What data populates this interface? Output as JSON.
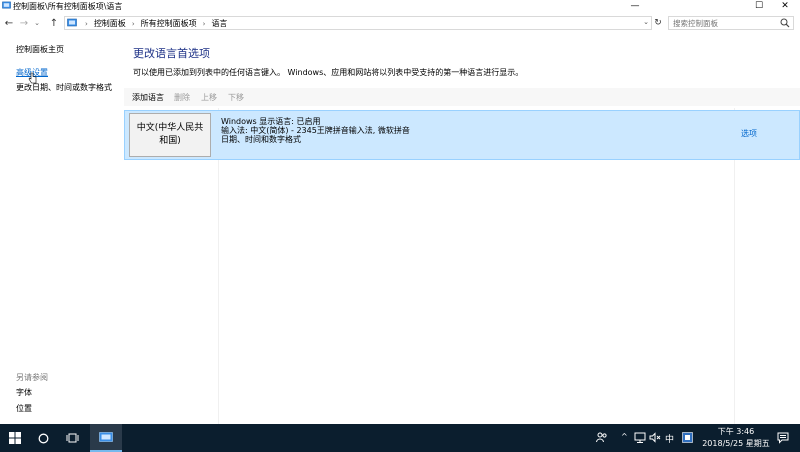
{
  "window": {
    "title": "控制面板\\所有控制面板项\\语言",
    "controls": {
      "minimize": "—",
      "maximize": "☐",
      "close": "✕"
    }
  },
  "address": {
    "back": "←",
    "forward": "→",
    "recent": "⌄",
    "up": "↑",
    "breadcrumbs": [
      "控制面板",
      "所有控制面板项",
      "语言"
    ],
    "separator": "›",
    "dropdown": "⌄",
    "refresh": "↻",
    "search_placeholder": "搜索控制面板"
  },
  "sidebar": {
    "home": "控制面板主页",
    "advanced": "高级设置",
    "datetime": "更改日期、时间或数字格式",
    "see_also": "另请参阅",
    "fonts": "字体",
    "location": "位置"
  },
  "main": {
    "title": "更改语言首选项",
    "description": "可以使用已添加到列表中的任何语言键入。 Windows、应用和网站将以列表中受支持的第一种语言进行显示。",
    "toolbar": {
      "add": "添加语言",
      "delete": "删除",
      "up": "上移",
      "down": "下移"
    },
    "language": {
      "name": "中文(中华人民共和国)",
      "display": "Windows 显示语言: 已启用",
      "input": "输入法: 中文(简体) - 2345王牌拼音输入法, 微软拼音",
      "format": "日期、时间和数字格式",
      "options": "选项"
    }
  },
  "taskbar": {
    "ime": "中",
    "time": "下午 3:46",
    "date": "2018/5/25 星期五"
  },
  "colors": {
    "title": "#1e3287",
    "link": "#0066cc",
    "selected_bg": "#cce8ff",
    "selected_border": "#99d1ff",
    "taskbar": "#0b1e2e"
  }
}
